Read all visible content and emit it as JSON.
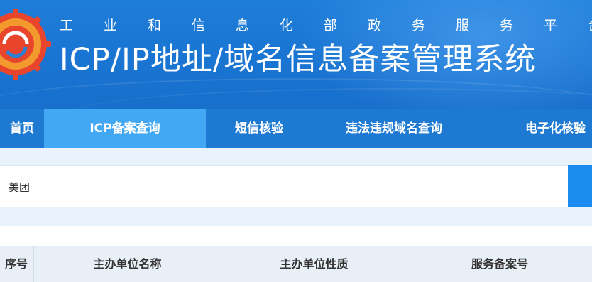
{
  "header": {
    "subtitle_chars": [
      "工",
      "业",
      "和",
      "信",
      "息",
      "化",
      "部",
      "政",
      "务",
      "服",
      "务",
      "平",
      "台"
    ],
    "title": "ICP/IP地址/域名信息备案管理系统",
    "logo_icon": "ministry-logo-icon",
    "colors": {
      "banner": "#1a76d3",
      "logo_red": "#e8452c",
      "logo_orange": "#f29a2e"
    }
  },
  "nav": {
    "items": [
      {
        "label": "首页"
      },
      {
        "label": "ICP备案查询"
      },
      {
        "label": "短信核验"
      },
      {
        "label": "违法违规域名查询"
      },
      {
        "label": "电子化核验"
      }
    ],
    "active_index": 1,
    "colors": {
      "bar": "#1e79d2",
      "active": "#43a8f4"
    }
  },
  "search": {
    "value": "美团",
    "button_color": "#1a8cf0"
  },
  "table": {
    "headers": [
      "序号",
      "主办单位名称",
      "主办单位性质",
      "服务备案号"
    ]
  }
}
